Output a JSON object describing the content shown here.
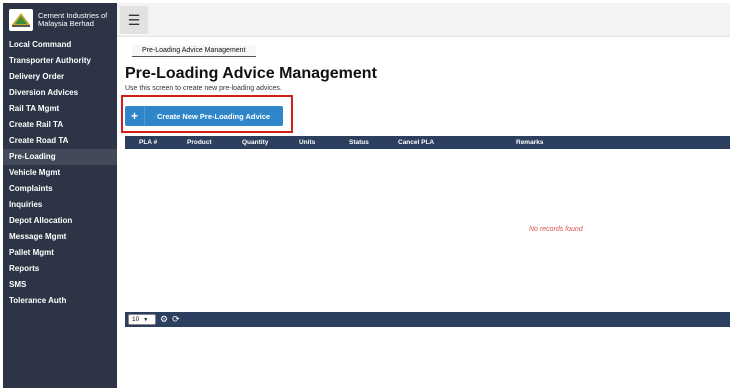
{
  "brand": {
    "name_line1": "Cement Industries of",
    "name_line2": "Malaysia Berhad"
  },
  "sidebar": {
    "items": [
      {
        "label": "Local Command"
      },
      {
        "label": "Transporter Authority"
      },
      {
        "label": "Delivery Order"
      },
      {
        "label": "Diversion Advices"
      },
      {
        "label": "Rail TA Mgmt"
      },
      {
        "label": "Create Rail TA"
      },
      {
        "label": "Create Road TA"
      },
      {
        "label": "Pre-Loading",
        "active": true
      },
      {
        "label": "Vehicle Mgmt"
      },
      {
        "label": "Complaints"
      },
      {
        "label": "Inquiries"
      },
      {
        "label": "Depot Allocation"
      },
      {
        "label": "Message Mgmt"
      },
      {
        "label": "Pallet Mgmt"
      },
      {
        "label": "Reports"
      },
      {
        "label": "SMS"
      },
      {
        "label": "Tolerance Auth"
      }
    ]
  },
  "topbar": {
    "menu_icon": "hamburger-icon"
  },
  "main": {
    "breadcrumb": "Pre-Loading Advice Management",
    "title": "Pre-Loading Advice Management",
    "subtitle": "Use this screen to create new pre-loading advices.",
    "create_button": {
      "icon": "+",
      "label": "Create New Pre-Loading Advice"
    },
    "table": {
      "columns": [
        "PLA #",
        "Product",
        "Quantity",
        "Units",
        "Status",
        "Cancel PLA",
        "Remarks"
      ],
      "rows": [],
      "empty_message": "No records found"
    },
    "pagination": {
      "page_size": "10",
      "settings_icon": "gear-icon",
      "refresh_icon": "refresh-icon"
    }
  },
  "colors": {
    "sidebar_bg": "#2c3446",
    "table_header_bg": "#2c3f5e",
    "primary_button": "#2f86c9",
    "highlight_border": "#d0201a",
    "empty_text": "#d9534f"
  }
}
